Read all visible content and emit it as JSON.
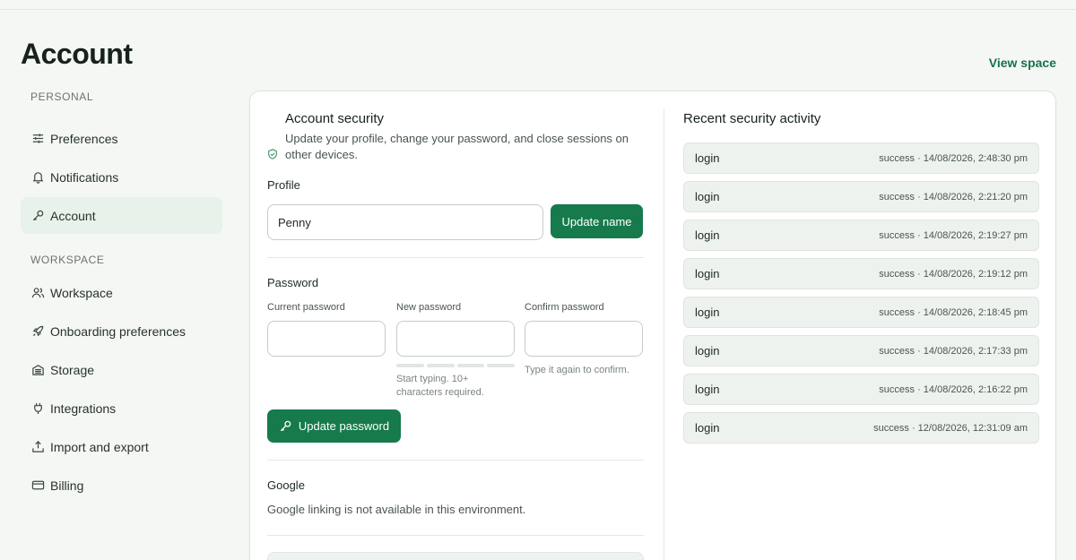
{
  "page": {
    "title": "Account",
    "view_space": "View space"
  },
  "sidebar": {
    "personal_label": "PERSONAL",
    "workspace_label": "WORKSPACE",
    "personal_items": [
      {
        "label": "Preferences",
        "icon": "sliders-icon"
      },
      {
        "label": "Notifications",
        "icon": "bell-icon"
      },
      {
        "label": "Account",
        "icon": "key-icon",
        "active": true
      }
    ],
    "workspace_items": [
      {
        "label": "Workspace",
        "icon": "users-icon"
      },
      {
        "label": "Onboarding preferences",
        "icon": "rocket-icon"
      },
      {
        "label": "Storage",
        "icon": "storage-icon"
      },
      {
        "label": "Integrations",
        "icon": "plug-icon"
      },
      {
        "label": "Import and export",
        "icon": "upload-icon"
      },
      {
        "label": "Billing",
        "icon": "credit-card-icon"
      }
    ]
  },
  "security": {
    "title": "Account security",
    "description": "Update your profile, change your password, and close sessions on other devices.",
    "profile": {
      "heading": "Profile",
      "name_value": "Penny",
      "update_button": "Update name"
    },
    "password": {
      "heading": "Password",
      "current_label": "Current password",
      "new_label": "New password",
      "confirm_label": "Confirm password",
      "new_hint": "Start typing. 10+ characters required.",
      "confirm_hint": "Type it again to confirm.",
      "update_button": "Update password"
    },
    "google": {
      "heading": "Google",
      "text": "Google linking is not available in this environment."
    }
  },
  "activity": {
    "title": "Recent security activity",
    "rows": [
      {
        "event": "login",
        "meta": "success · 14/08/2026, 2:48:30 pm"
      },
      {
        "event": "login",
        "meta": "success · 14/08/2026, 2:21:20 pm"
      },
      {
        "event": "login",
        "meta": "success · 14/08/2026, 2:19:27 pm"
      },
      {
        "event": "login",
        "meta": "success · 14/08/2026, 2:19:12 pm"
      },
      {
        "event": "login",
        "meta": "success · 14/08/2026, 2:18:45 pm"
      },
      {
        "event": "login",
        "meta": "success · 14/08/2026, 2:17:33 pm"
      },
      {
        "event": "login",
        "meta": "success · 14/08/2026, 2:16:22 pm"
      },
      {
        "event": "login",
        "meta": "success · 12/08/2026, 12:31:09 am"
      }
    ]
  },
  "colors": {
    "accent": "#167a4c",
    "active_nav_bg": "#e6f2ea"
  }
}
